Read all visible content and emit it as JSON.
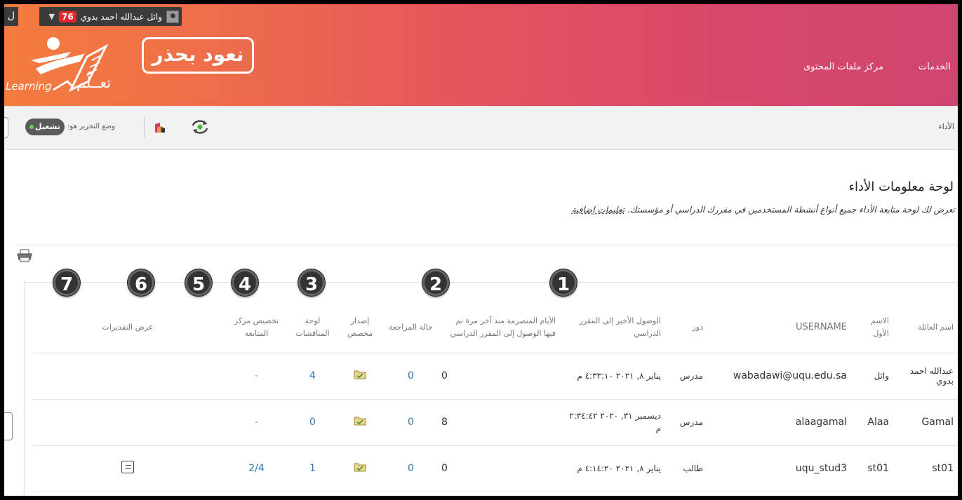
{
  "header": {
    "user_name": "وائل عبدالله احمد بدوي",
    "notification_count": "76",
    "menu_glyph": "▼",
    "left_tab_glyph": "ل",
    "brand_logo_text": "نعود بحذر",
    "learning_logo_en": "Learning",
    "learning_logo_ar": "تعــلُم",
    "nav": [
      {
        "label": "الخدمات"
      },
      {
        "label": "مركز ملفات المحتوى"
      }
    ]
  },
  "toolbar": {
    "breadcrumb": "الأداء",
    "edit_mode_label": "وضع التحرير هو:",
    "edit_mode_value": "تشغيل"
  },
  "page": {
    "title": "لوحة معلومات الأداء",
    "description": "تعرض لك لوحة متابعة الأداء جميع أنواع أنشطة المستخدمين في مقررك الدراسي أو مؤسستك.",
    "help_link": "تعليمات إضافية"
  },
  "markers": [
    "1",
    "2",
    "3",
    "4",
    "5",
    "6",
    "7"
  ],
  "table": {
    "headers": {
      "family_name": "اسم العائلة",
      "first_name": "الاسم الأول",
      "username": "USERNAME",
      "role": "دور",
      "last_access": "الوصول الأخير إلى المقرر الدراسي",
      "days_since": "الأيام المنصرمة منذ آخر مرة تم فيها الوصول إلى المقرر الدراسي",
      "review_status": "حالة المراجعة",
      "adaptive_release": "إصدار مخصص",
      "discussion_board": "لوحة المناقشات",
      "early_warning": "تخصيص مركز المتابعة",
      "view_grades": "عرض التقديرات"
    },
    "rows": [
      {
        "family_name": "عبدالله احمد بدوي",
        "first_name": "وائل",
        "username": "wabadawi@uqu.edu.sa",
        "role": "مدرس",
        "last_access": "يناير ٨, ٢٠٢١ ٤:٣٣:١٠ م",
        "days_since": "0",
        "review_status": "0",
        "discussion_board": "4",
        "early_warning": "-",
        "view_grades": ""
      },
      {
        "family_name": "Gamal",
        "first_name": "Alaa",
        "username": "alaagamal",
        "role": "مدرس",
        "last_access": "ديسمبر ٣١, ٢٠٢٠ ٢:٣٤:٤٢ م",
        "days_since": "8",
        "review_status": "0",
        "discussion_board": "0",
        "early_warning": "-",
        "view_grades": ""
      },
      {
        "family_name": "st01",
        "first_name": "st01",
        "username": "uqu_stud3",
        "role": "طالب",
        "last_access": "يناير ٨, ٢٠٢١ ٤:١٤:٢٠ م",
        "days_since": "0",
        "review_status": "0",
        "discussion_board": "1",
        "early_warning": "2/4",
        "view_grades": "report"
      }
    ]
  },
  "colors": {
    "banner_start": "#f47c3e",
    "banner_end": "#cf4570",
    "link": "#2f77b3",
    "badge": "#e5242b"
  }
}
